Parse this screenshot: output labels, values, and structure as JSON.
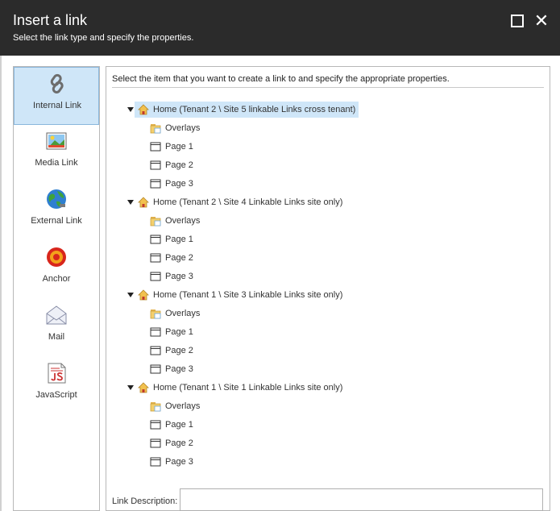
{
  "dialog": {
    "title": "Insert a link",
    "subtitle": "Select the link type and specify the properties."
  },
  "sidebar": {
    "items": [
      {
        "label": "Internal Link",
        "icon": "chain-link-icon",
        "active": true
      },
      {
        "label": "Media Link",
        "icon": "image-icon",
        "active": false
      },
      {
        "label": "External Link",
        "icon": "globe-icon",
        "active": false
      },
      {
        "label": "Anchor",
        "icon": "anchor-target-icon",
        "active": false
      },
      {
        "label": "Mail",
        "icon": "envelope-icon",
        "active": false
      },
      {
        "label": "JavaScript",
        "icon": "javascript-icon",
        "active": false
      }
    ]
  },
  "main": {
    "instructions": "Select the item that you want to create a link to and specify the appropriate properties.",
    "tree": [
      {
        "label": "Home (Tenant 2 \\ Site 5 linkable Links cross tenant)",
        "selected": true,
        "children": [
          "Overlays",
          "Page 1",
          "Page 2",
          "Page 3"
        ]
      },
      {
        "label": "Home (Tenant 2 \\ Site 4 Linkable Links site only)",
        "selected": false,
        "children": [
          "Overlays",
          "Page 1",
          "Page 2",
          "Page 3"
        ]
      },
      {
        "label": "Home (Tenant 1 \\ Site 3 Linkable Links site only)",
        "selected": false,
        "children": [
          "Overlays",
          "Page 1",
          "Page 2",
          "Page 3"
        ]
      },
      {
        "label": "Home (Tenant 1 \\ Site 1 Linkable Links site only)",
        "selected": false,
        "children": [
          "Overlays",
          "Page 1",
          "Page 2",
          "Page 3"
        ]
      }
    ],
    "link_description_label": "Link Description:",
    "link_description_value": ""
  },
  "colors": {
    "titlebar": "#2b2b2b",
    "selection": "#cfe6f8"
  }
}
